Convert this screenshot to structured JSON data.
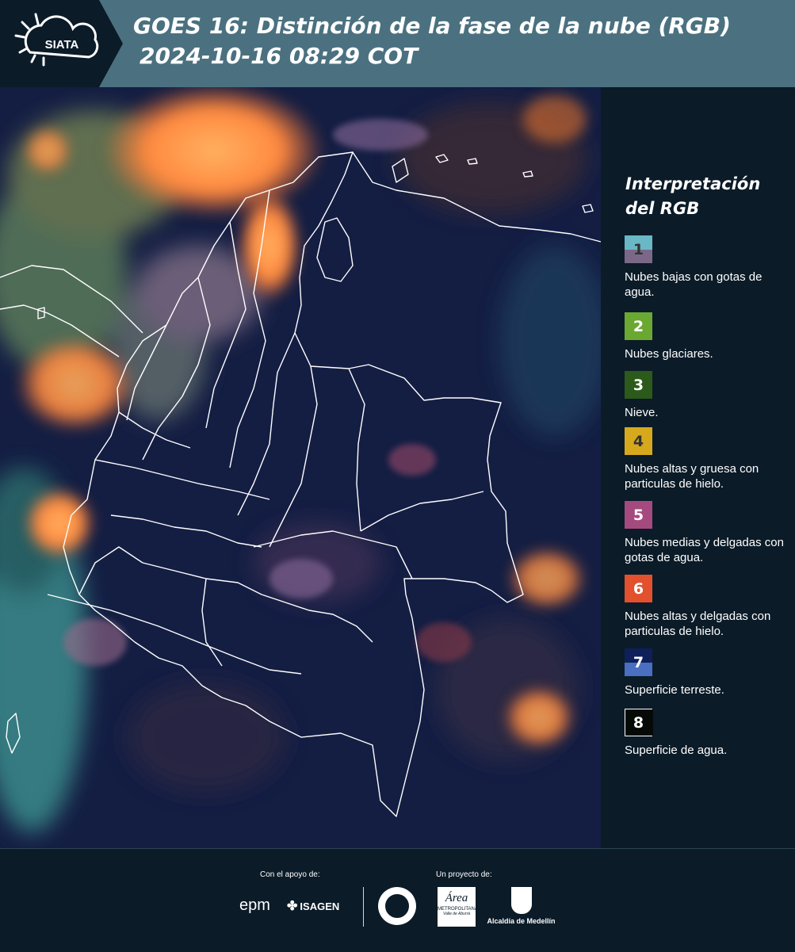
{
  "header": {
    "logo_text": "SIATA",
    "title_line1": "GOES 16: Distinción de la fase de la nube (RGB)",
    "title_line2": "2024-10-16 08:29 COT",
    "background_color": "#4b7180"
  },
  "legend": {
    "title": "Interpretación del RGB",
    "items": [
      {
        "number": "1",
        "label": "Nubes bajas con gotas de agua.",
        "color_top": "#6ab8c6",
        "color_bottom": "#7b6888",
        "text_color": "#333333"
      },
      {
        "number": "2",
        "label": "Nubes glaciares.",
        "color_top": "#6aa832",
        "color_bottom": "#6aa832",
        "text_color": "#ffffff"
      },
      {
        "number": "3",
        "label": "Nieve.",
        "color_top": "#2c5a1a",
        "color_bottom": "#2c5a1a",
        "text_color": "#ffffff"
      },
      {
        "number": "4",
        "label": "Nubes altas y gruesa con particulas de hielo.",
        "color_top": "#d6a91c",
        "color_bottom": "#d6a91c",
        "text_color": "#333333"
      },
      {
        "number": "5",
        "label": "Nubes medias y delgadas con gotas de agua.",
        "color_top": "#a54a7e",
        "color_bottom": "#a54a7e",
        "text_color": "#ffffff"
      },
      {
        "number": "6",
        "label": "Nubes altas y delgadas con particulas de hielo.",
        "color_top": "#e2502e",
        "color_bottom": "#e2502e",
        "text_color": "#ffffff"
      },
      {
        "number": "7",
        "label": "Superficie terreste.",
        "color_top": "#0f1f5a",
        "color_bottom": "#4a6fc0",
        "text_color": "#ffffff"
      },
      {
        "number": "8",
        "label": "Superficie de agua.",
        "color_top": "#050a07",
        "color_bottom": "#050a07",
        "text_color": "#ffffff"
      }
    ]
  },
  "footer": {
    "support_caption": "Con el apoyo de:",
    "project_caption": "Un proyecto de:",
    "logos": {
      "epm": "epm",
      "isagen": "ISAGEN",
      "area_main": "Área",
      "area_sub": "METROPOLITANA",
      "area_sub2": "Valle de Aburrá",
      "alcaldia": "Alcaldía de Medellín"
    }
  }
}
